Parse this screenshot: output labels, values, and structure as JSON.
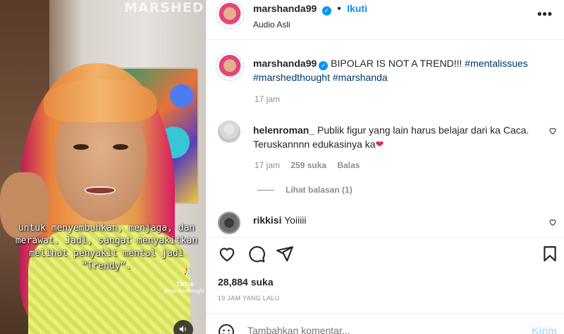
{
  "video": {
    "watermark": "MARSHED",
    "caption_lines": [
      "untuk menyembuhkan, menjaga, dan",
      "merawat. Jadi, sangat menyakitkan",
      "melihat penyakit mental jadi “Trendy”."
    ],
    "tiktok_label": "TikTok",
    "tiktok_handle": "@marshedthought",
    "sound_icon": "speaker-icon"
  },
  "header": {
    "username": "marshanda99",
    "follow_label": "Ikuti",
    "audio_label": "Audio Asli",
    "more_icon": "more-icon"
  },
  "caption": {
    "username": "marshanda99",
    "text": "BIPOLAR IS NOT A TREND!!!",
    "hashtags": [
      "#mentalissues",
      "#marshedthought",
      "#marshanda"
    ],
    "time": "17 jam"
  },
  "comments": [
    {
      "username": "helenroman_",
      "text": "Publik figur yang lain harus belajar dari ka Caca.",
      "text2": "Teruskannnn edukasinya ka",
      "emoji": "❤️",
      "time": "17 jam",
      "likes": "259 suka",
      "reply_label": "Balas",
      "view_replies": "Lihat balasan (1)"
    },
    {
      "username": "rikkisi",
      "text": "Yoiiiii"
    }
  ],
  "actions": {
    "like_icon": "heart-icon",
    "comment_icon": "comment-icon",
    "share_icon": "share-icon",
    "save_icon": "bookmark-icon"
  },
  "likes_count": "28,884 suka",
  "post_date": "19 JAM YANG LALU",
  "comment_box": {
    "placeholder": "Tambahkan komentar...",
    "post_label": "Kirim"
  },
  "colors": {
    "accent": "#0095f6",
    "hashtag": "#00376b",
    "muted": "#8e8e8e"
  }
}
